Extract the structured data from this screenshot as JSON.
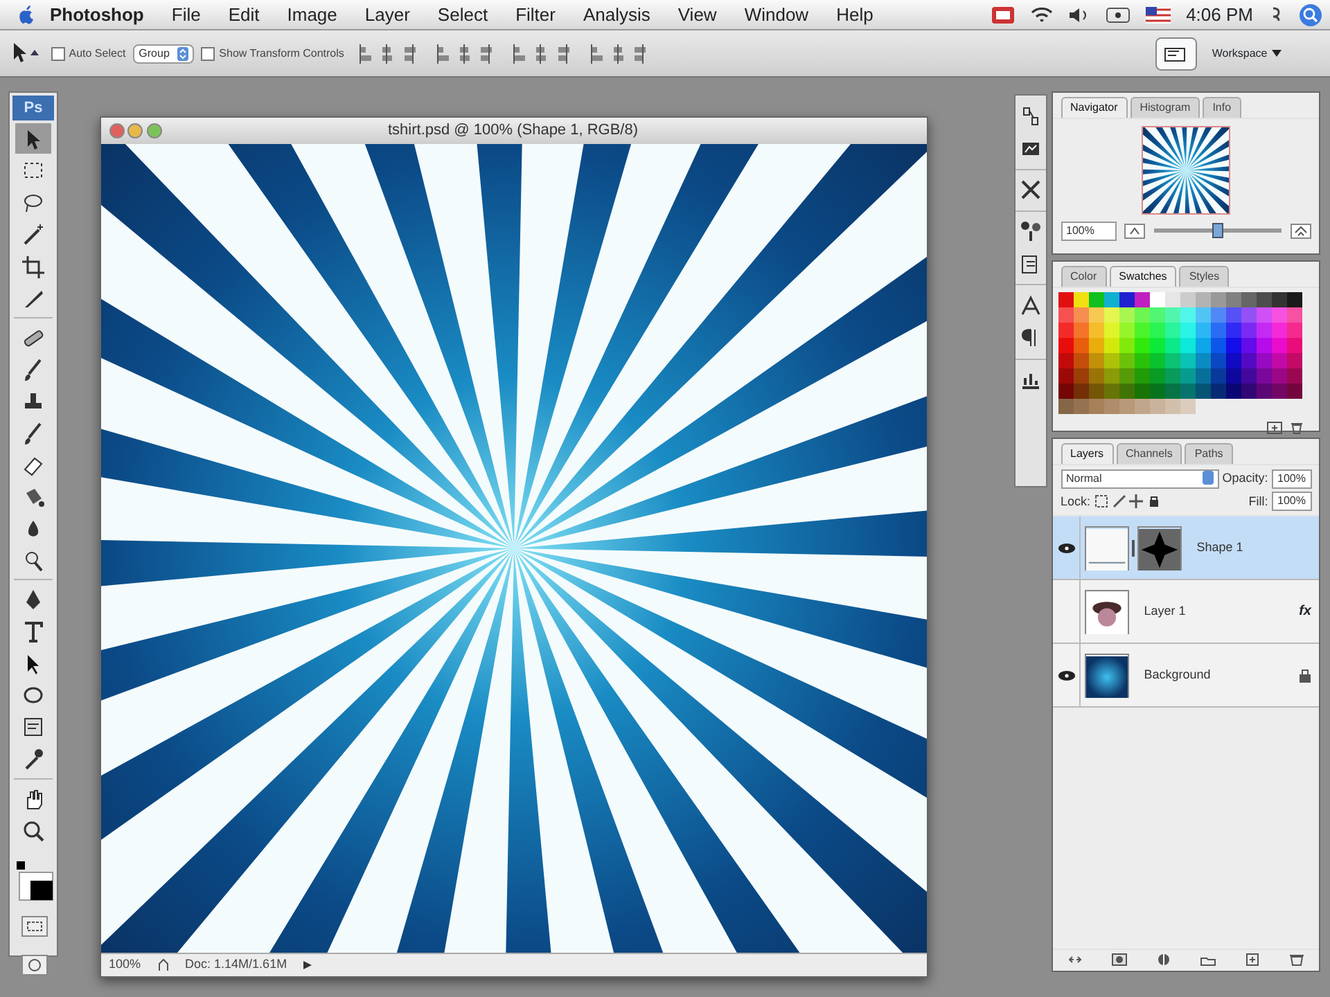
{
  "menu_bar": {
    "app_name": "Photoshop",
    "items": [
      "File",
      "Edit",
      "Image",
      "Layer",
      "Select",
      "Filter",
      "Analysis",
      "View",
      "Window",
      "Help"
    ],
    "clock": "4:06 PM"
  },
  "options_bar": {
    "auto_select": {
      "label": "Auto Select",
      "checked": false
    },
    "auto_select_target": "Group",
    "show_transform": {
      "label": "Show Transform Controls",
      "checked": false
    },
    "workspace": "Workspace"
  },
  "toolbox": {
    "logo": "Ps",
    "tools": [
      {
        "kind": "move",
        "selected": true
      },
      {
        "kind": "marquee",
        "selected": false
      },
      {
        "kind": "lasso",
        "selected": false
      },
      {
        "kind": "wand",
        "selected": false
      },
      {
        "kind": "crop",
        "selected": false
      },
      {
        "kind": "slice",
        "selected": false
      },
      {
        "kind": "bandage",
        "selected": false
      },
      {
        "kind": "brush",
        "selected": false
      },
      {
        "kind": "stamp",
        "selected": false
      },
      {
        "kind": "brush",
        "selected": false
      },
      {
        "kind": "eraser",
        "selected": false
      },
      {
        "kind": "bucket",
        "selected": false
      },
      {
        "kind": "drop",
        "selected": false
      },
      {
        "kind": "dodge",
        "selected": false
      },
      {
        "kind": "pen",
        "selected": false
      },
      {
        "kind": "type",
        "selected": false
      },
      {
        "kind": "arrow",
        "selected": false
      },
      {
        "kind": "ellipse",
        "selected": false
      },
      {
        "kind": "note",
        "selected": false
      },
      {
        "kind": "eyedropper",
        "selected": false
      },
      {
        "kind": "hand",
        "selected": false
      },
      {
        "kind": "zoom",
        "selected": false
      }
    ]
  },
  "document": {
    "title": "tshirt.psd @ 100% (Shape 1, RGB/8)",
    "zoom": "100%",
    "doc_size": "Doc: 1.14M/1.61M"
  },
  "navigator": {
    "tabs": [
      {
        "label": "Navigator",
        "selected": true
      },
      {
        "label": "Histogram",
        "selected": false
      },
      {
        "label": "Info",
        "selected": false
      }
    ],
    "zoom": "100%",
    "level": 0.5
  },
  "color_panel": {
    "tabs": [
      {
        "label": "Color",
        "selected": false
      },
      {
        "label": "Swatches",
        "selected": true
      },
      {
        "label": "Styles",
        "selected": false
      }
    ]
  },
  "layers_panel": {
    "tabs": [
      {
        "label": "Layers",
        "selected": true
      },
      {
        "label": "Channels",
        "selected": false
      },
      {
        "label": "Paths",
        "selected": false
      }
    ],
    "blend_mode": "Normal",
    "opacity_label": "Opacity:",
    "opacity": "100%",
    "lock_label": "Lock:",
    "fill_label": "Fill:",
    "fill": "100%",
    "layers": [
      {
        "name": "Shape 1",
        "kind": "shape",
        "visible": true,
        "selected": true,
        "locked": false
      },
      {
        "name": "Layer 1",
        "kind": "photo",
        "visible": false,
        "selected": false,
        "locked": false,
        "effects": "fx"
      },
      {
        "name": "Background",
        "kind": "gradient",
        "visible": true,
        "selected": false,
        "locked": true
      }
    ]
  }
}
